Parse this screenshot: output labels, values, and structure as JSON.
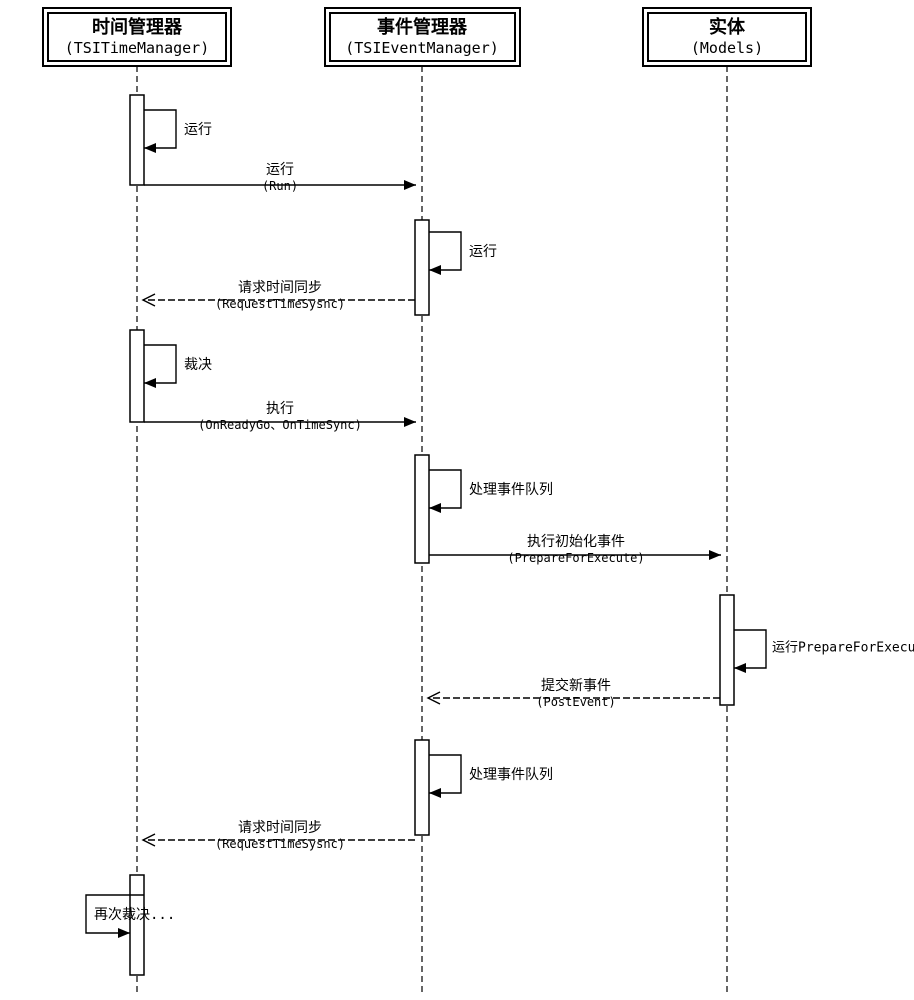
{
  "participants": [
    {
      "title_cn": "时间管理器",
      "title_en": "(TSITimeManager)"
    },
    {
      "title_cn": "事件管理器",
      "title_en": "(TSIEventManager)"
    },
    {
      "title_cn": "实体",
      "title_en": "(Models)"
    }
  ],
  "self_messages": {
    "run1": "运行",
    "run2": "运行",
    "verdict": "裁决",
    "proc_q1": "处理事件队列",
    "run_prep": "运行PrepareForExecute",
    "proc_q2": "处理事件队列",
    "verdict_again": "再次裁决..."
  },
  "messages": {
    "run_forward_cn": "运行",
    "run_forward_en": "(Run)",
    "req_sync1_cn": "请求时间同步",
    "req_sync1_en": "(RequestTimeSysnc)",
    "exec_cn": "执行",
    "exec_en": "(OnReadyGo、OnTimeSync)",
    "exec_init_cn": "执行初始化事件",
    "exec_init_en": "(PrepareForExecute)",
    "post_event_cn": "提交新事件",
    "post_event_en": "(PostEvent)",
    "req_sync2_cn": "请求时间同步",
    "req_sync2_en": "(RequestTimeSysnc)"
  }
}
